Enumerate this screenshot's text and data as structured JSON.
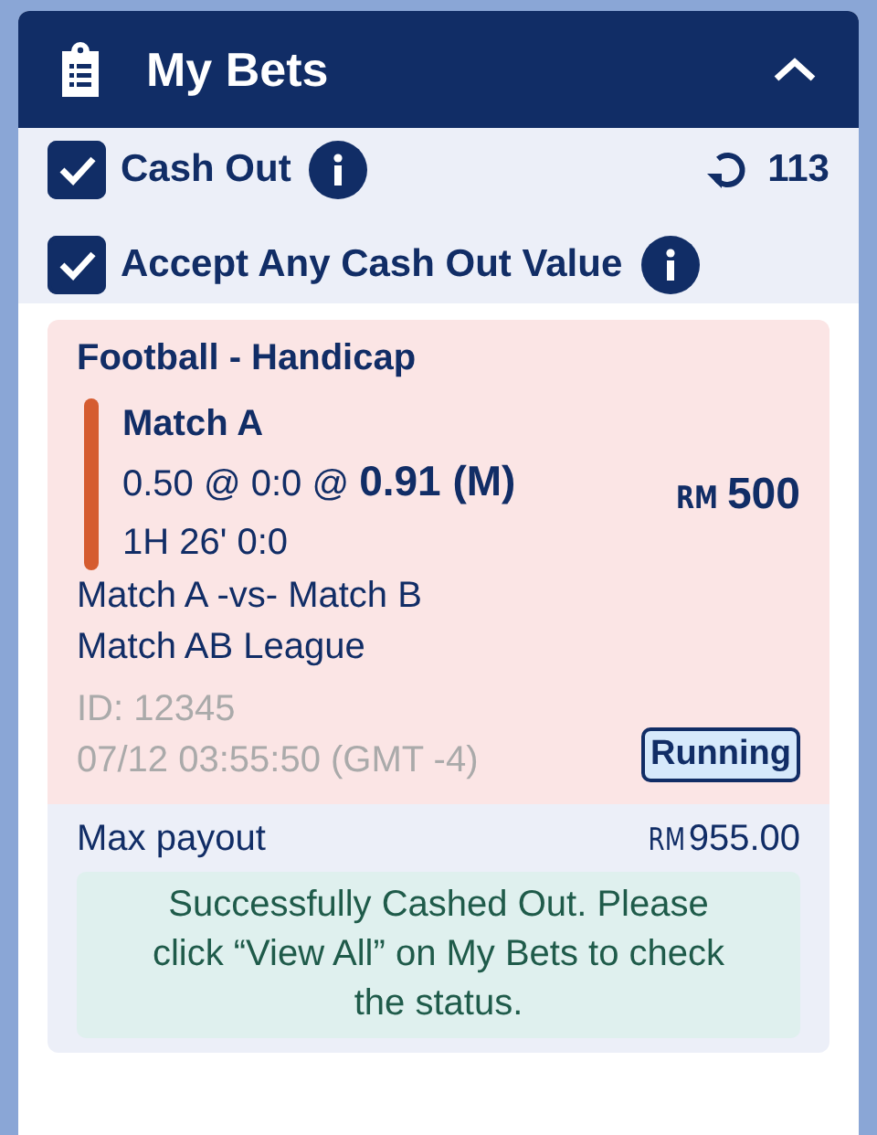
{
  "header": {
    "title": "My Bets",
    "expanded": true
  },
  "options": [
    {
      "label": "Cash Out",
      "checked": true,
      "info": true
    },
    {
      "label": "Accept Any Cash Out Value",
      "checked": true,
      "info": true
    }
  ],
  "refresh": {
    "count": "113"
  },
  "bet": {
    "type": "Football - Handicap",
    "selection": "Match A",
    "odds": "0.50 @ 0:0 @ **0.91 (M)**",
    "time": "1H 26' 0:0",
    "currency": "RM",
    "stake": "500",
    "color": "#d55c30",
    "match": "Match A -vs- Match B",
    "league": "Match AB League",
    "id": "ID: 12345",
    "date": "07/12 03:55:50 (GMT -4)",
    "status": "Running"
  },
  "payout": {
    "label": "Max payout",
    "currency": "RM",
    "amount": "955.00"
  },
  "message": "Successfully Cashed Out. Please click “View All” on My Bets to check the status."
}
